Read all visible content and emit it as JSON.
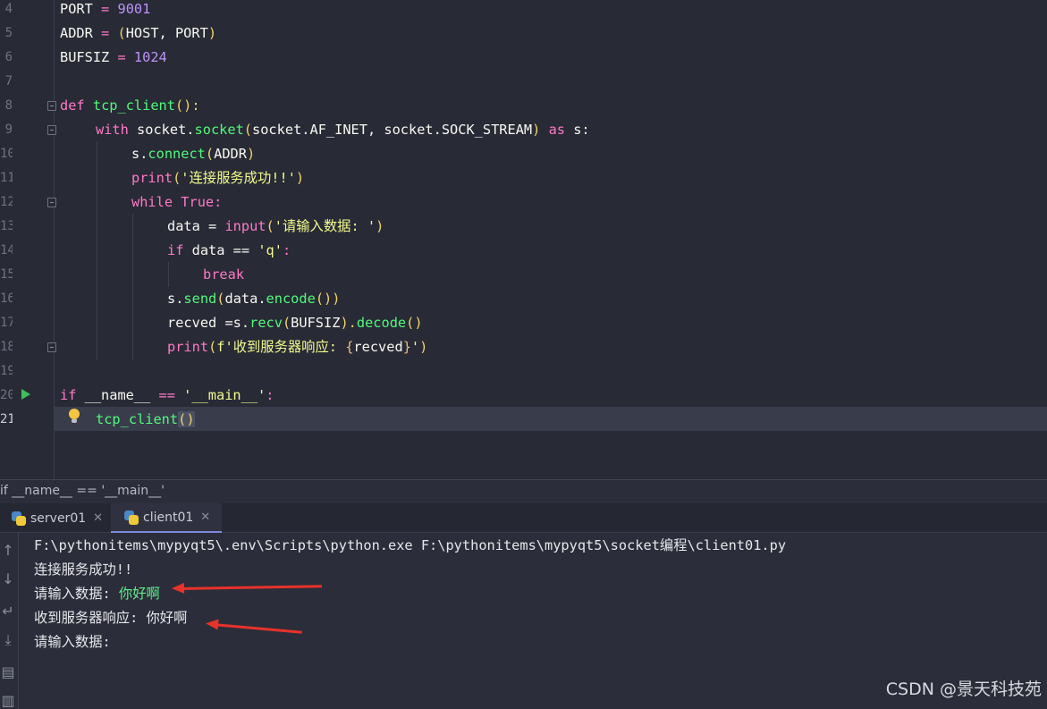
{
  "editor": {
    "line_numbers": [
      "4",
      "5",
      "6",
      "7",
      "8",
      "9",
      "10",
      "11",
      "12",
      "13",
      "14",
      "15",
      "16",
      "17",
      "18",
      "19",
      "20",
      "21"
    ],
    "code": {
      "l4_name": "PORT",
      "l4_eq": " = ",
      "l4_val": "9001",
      "l5_name": "ADDR",
      "l5_eq": " = ",
      "l5_open": "(",
      "l5_args": "HOST, PORT",
      "l5_close": ")",
      "l6_name": "BUFSIZ",
      "l6_eq": " = ",
      "l6_val": "1024",
      "l8_def": "def",
      "l8_fn": "tcp_client",
      "l8_rest": "():",
      "l9_with": "with",
      "l9_a": " socket.",
      "l9_fn": "socket",
      "l9_open": "(",
      "l9_args": "socket.AF_INET, socket.SOCK_STREAM",
      "l9_close": ")",
      "l9_as": " as",
      "l9_s": " s:",
      "l10_a": "s.",
      "l10_fn": "connect",
      "l10_open": "(",
      "l10_args": "ADDR",
      "l10_close": ")",
      "l11_fn": "print",
      "l11_open": "(",
      "l11_str": "'连接服务成功!!'",
      "l11_close": ")",
      "l12_kw": "while",
      "l12_true": " True",
      "l12_colon": ":",
      "l13_a": "data = ",
      "l13_fn": "input",
      "l13_open": "(",
      "l13_str": "'请输入数据: '",
      "l13_close": ")",
      "l14_kw": "if",
      "l14_a": " data == ",
      "l14_str": "'q'",
      "l14_colon": ":",
      "l15_kw": "break",
      "l16_a": "s.",
      "l16_fn": "send",
      "l16_open": "(",
      "l16_b": "data.",
      "l16_fn2": "encode",
      "l16_close": "())",
      "l17_a": "recved =s.",
      "l17_fn": "recv",
      "l17_open": "(",
      "l17_args": "BUFSIZ",
      "l17_close": ").",
      "l17_fn2": "decode",
      "l17_paren": "()",
      "l18_fn": "print",
      "l18_open": "(",
      "l18_str1": "f'收到服务器响应: ",
      "l18_brace1": "{",
      "l18_var": "recved",
      "l18_brace2": "}",
      "l18_str2": "'",
      "l18_close": ")",
      "l20_kw": "if",
      "l20_a": " __name__ ",
      "l20_op": "==",
      "l20_str": " '__main__'",
      "l20_colon": ":",
      "l21_fn": "tcp_client",
      "l21_open": "(",
      "l21_close": ")"
    }
  },
  "breadcrumb": {
    "text": "if __name__ == '__main__'"
  },
  "run_tabs": [
    {
      "label": "server01",
      "close": "✕"
    },
    {
      "label": "client01",
      "close": "✕"
    }
  ],
  "toolbar_icons": [
    "arrow-up-icon",
    "arrow-down-icon",
    "soft-wrap-icon",
    "scroll-to-end-icon",
    "print-icon",
    "trash-icon"
  ],
  "console": {
    "command": "F:\\pythonitems\\mypyqt5\\.env\\Scripts\\python.exe F:\\pythonitems\\mypyqt5\\socket编程\\client01.py",
    "line2": "连接服务成功!!",
    "line3_prompt": "请输入数据: ",
    "line3_input": "你好啊",
    "line4": "收到服务器响应: 你好啊",
    "line5": "请输入数据: "
  },
  "watermark": "CSDN @景天科技苑",
  "colors": {
    "keyword": "#ff79c6",
    "function": "#50fa7b",
    "string": "#f1fa8c",
    "number": "#bd93f9",
    "annotation_arrow": "#e8322a"
  }
}
